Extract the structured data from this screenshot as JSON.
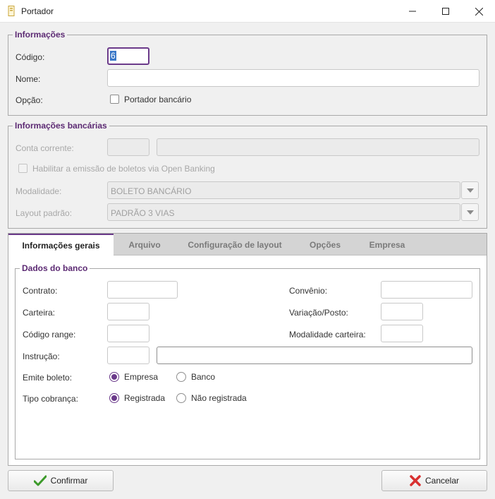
{
  "window": {
    "title": "Portador"
  },
  "info": {
    "legend": "Informações",
    "codigo_label": "Código:",
    "codigo_value": "6",
    "nome_label": "Nome:",
    "nome_value": "",
    "opcao_label": "Opção:",
    "portador_bancario_label": "Portador bancário"
  },
  "bank_info": {
    "legend": "Informações bancárias",
    "conta_corrente_label": "Conta corrente:",
    "open_banking_label": "Habilitar a emissão de boletos via Open Banking",
    "modalidade_label": "Modalidade:",
    "modalidade_value": "BOLETO BANCÁRIO",
    "layout_label": "Layout padrão:",
    "layout_value": "PADRÃO 3 VIAS"
  },
  "tabs": [
    {
      "label": "Informações gerais",
      "active": true
    },
    {
      "label": "Arquivo",
      "active": false
    },
    {
      "label": "Configuração de layout",
      "active": false
    },
    {
      "label": "Opções",
      "active": false
    },
    {
      "label": "Empresa",
      "active": false
    }
  ],
  "bank_data": {
    "legend": "Dados do banco",
    "contrato_label": "Contrato:",
    "convenio_label": "Convênio:",
    "carteira_label": "Carteira:",
    "variacao_label": "Variação/Posto:",
    "codigo_range_label": "Código range:",
    "modalidade_carteira_label": "Modalidade carteira:",
    "instrucao_label": "Instrução:",
    "emite_boleto_label": "Emite boleto:",
    "emite_boleto_options": [
      "Empresa",
      "Banco"
    ],
    "emite_boleto_selected": "Empresa",
    "tipo_cobranca_label": "Tipo cobrança:",
    "tipo_cobranca_options": [
      "Registrada",
      "Não registrada"
    ],
    "tipo_cobranca_selected": "Registrada"
  },
  "footer": {
    "confirm_label": "Confirmar",
    "cancel_label": "Cancelar"
  },
  "colors": {
    "accent": "#6b3a8a",
    "legend": "#5c2a73",
    "confirm_icon": "#3c9a2a",
    "cancel_icon": "#d83030"
  }
}
